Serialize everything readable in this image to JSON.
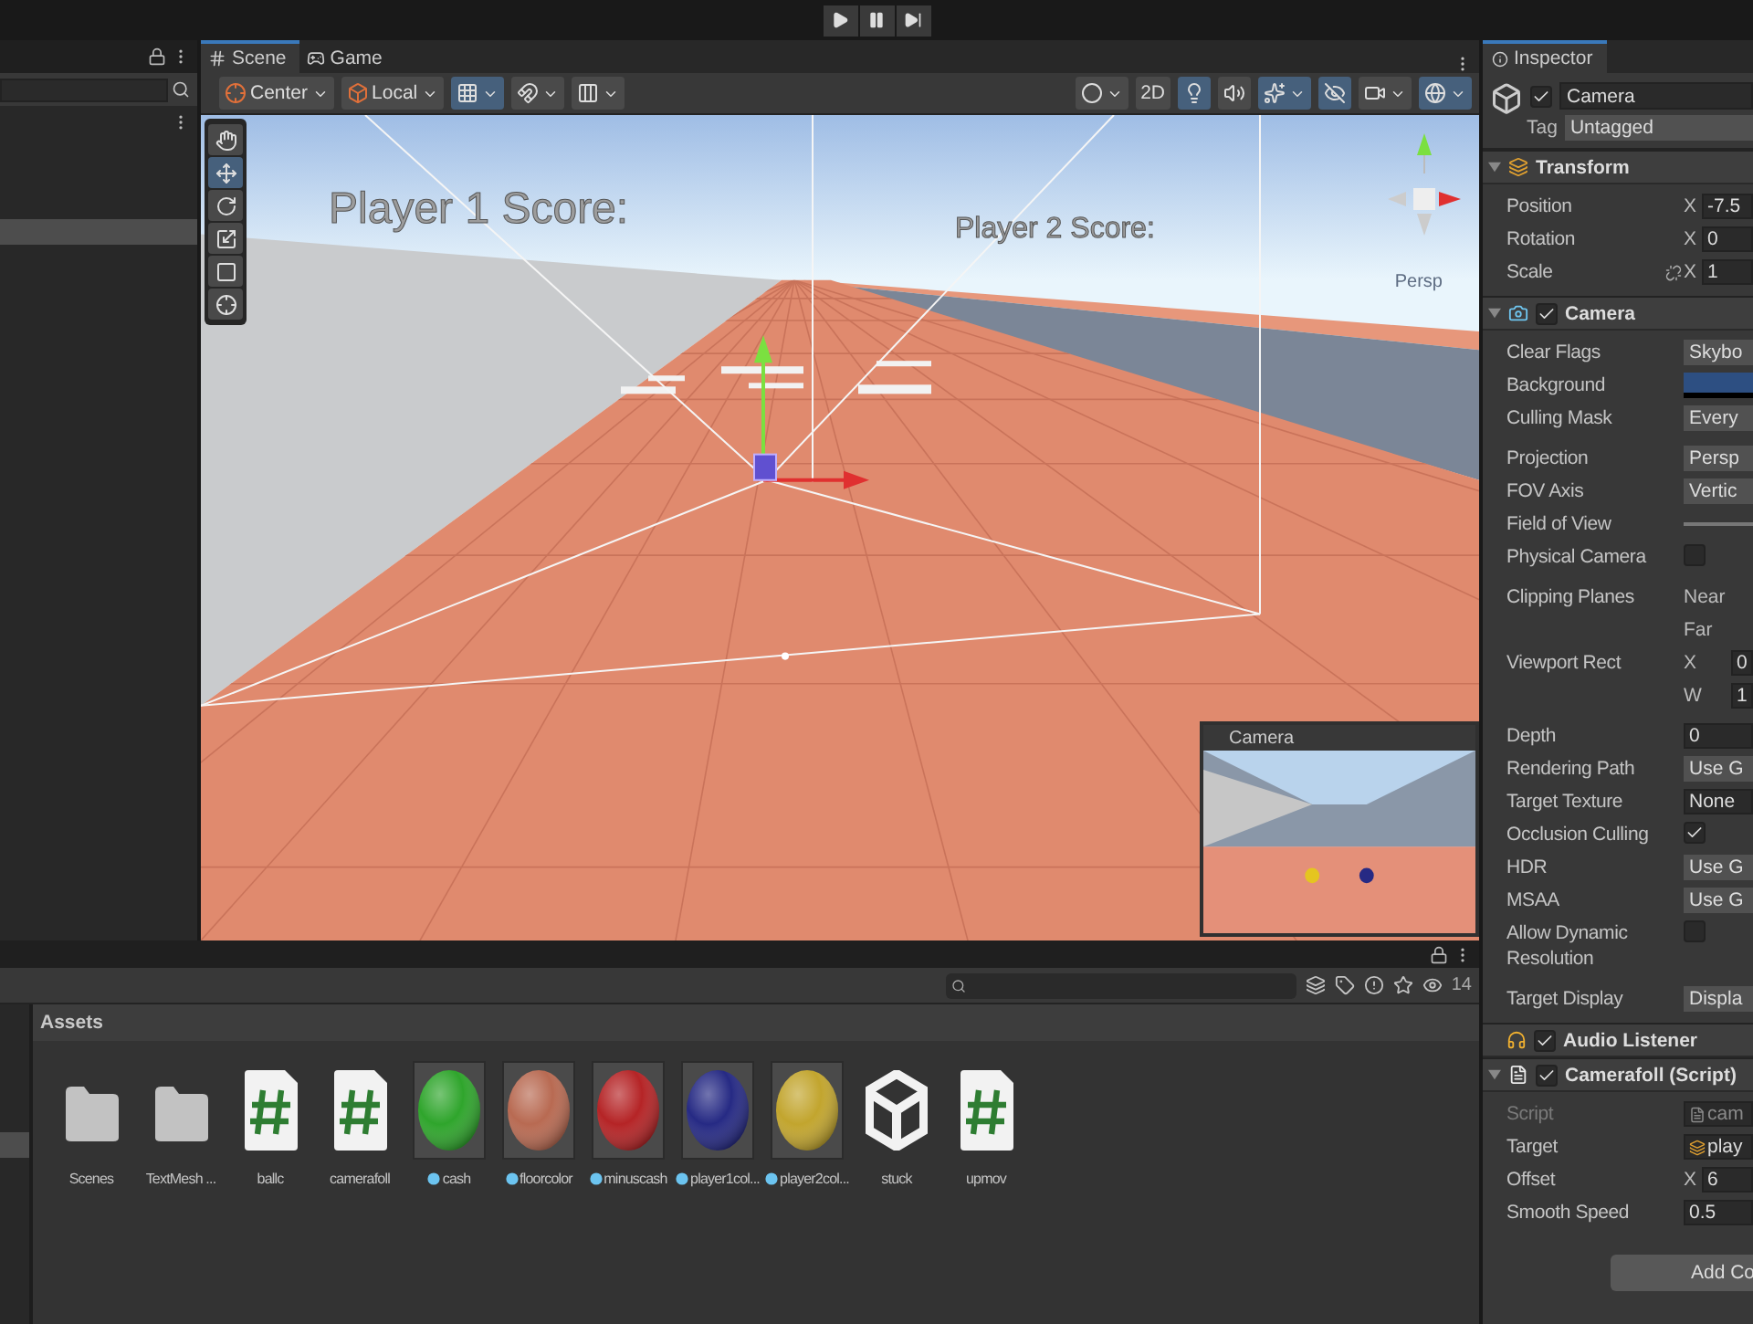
{
  "toolbar": {
    "buttons": [
      {
        "kind": "play"
      },
      {
        "kind": "pause"
      },
      {
        "kind": "step"
      }
    ]
  },
  "scene_view": {
    "tabs": [
      {
        "kind": "scene",
        "label": "Scene",
        "selected": true
      },
      {
        "kind": "game",
        "label": "Game",
        "selected": false
      }
    ],
    "left_tools": [
      {
        "kind": "pivot",
        "label": "Center",
        "dropdown": true,
        "on": false
      },
      {
        "kind": "space",
        "label": "Local",
        "dropdown": true,
        "on": false
      },
      {
        "kind": "grid_snap",
        "dropdown": true,
        "on": true
      },
      {
        "kind": "increment_snap",
        "dropdown": true,
        "on": false
      },
      {
        "kind": "grid",
        "dropdown": true,
        "on": false
      }
    ],
    "right_tools": [
      {
        "kind": "shading",
        "dropdown": true,
        "on": false
      },
      {
        "kind": "mode2d",
        "label": "2D",
        "dropdown": false,
        "on": false
      },
      {
        "kind": "lighting",
        "dropdown": false,
        "on": true
      },
      {
        "kind": "audio",
        "dropdown": false,
        "on": false
      },
      {
        "kind": "effects",
        "dropdown": true,
        "on": true
      },
      {
        "kind": "visibility",
        "dropdown": false,
        "on": true
      },
      {
        "kind": "camera",
        "dropdown": true,
        "on": false
      },
      {
        "kind": "gizmos",
        "dropdown": true,
        "on": true
      }
    ],
    "tools": [
      {
        "kind": "view",
        "selected": false
      },
      {
        "kind": "move",
        "selected": true
      },
      {
        "kind": "rotate",
        "selected": false
      },
      {
        "kind": "scale",
        "selected": false
      },
      {
        "kind": "rect",
        "selected": false
      },
      {
        "kind": "transform",
        "selected": false
      }
    ],
    "score_labels": [
      "Player 1 Score:",
      "Player 2 Score:"
    ],
    "orientation_label": "Persp",
    "camera_preview": {
      "title": "Camera"
    }
  },
  "inspector": {
    "tab": "Inspector",
    "object": {
      "enabled": true,
      "name": "Camera",
      "tag_label": "Tag",
      "tag": "Untagged"
    },
    "components": [
      {
        "kind": "transform",
        "name": "Transform",
        "expanded": true,
        "groups": [
          [
            {
              "kind": "vector",
              "label": "Position",
              "axis": "X",
              "value": "-7.5",
              "constrain": false
            },
            {
              "kind": "vector",
              "label": "Rotation",
              "axis": "X",
              "value": "0",
              "constrain": false
            },
            {
              "kind": "vector",
              "label": "Scale",
              "axis": "X",
              "value": "1",
              "constrain": true
            }
          ]
        ]
      },
      {
        "kind": "camera",
        "name": "Camera",
        "expanded": true,
        "enabled": true,
        "groups": [
          [
            {
              "kind": "dropdown",
              "label": "Clear Flags",
              "value": "Skybo"
            },
            {
              "kind": "color",
              "label": "Background",
              "color": "#2d4f82"
            },
            {
              "kind": "dropdown",
              "label": "Culling Mask",
              "value": "Every"
            }
          ],
          [
            {
              "kind": "dropdown",
              "label": "Projection",
              "value": "Persp"
            },
            {
              "kind": "dropdown",
              "label": "FOV Axis",
              "value": "Vertic"
            },
            {
              "kind": "slider",
              "label": "Field of View"
            },
            {
              "kind": "checkbox",
              "label": "Physical Camera",
              "checked": false
            }
          ],
          [
            {
              "kind": "pair",
              "label": "Clipping Planes",
              "rows": [
                {
                  "axis": "Near"
                },
                {
                  "axis": "Far"
                }
              ]
            },
            {
              "kind": "pair",
              "label": "Viewport Rect",
              "rows": [
                {
                  "axis": "X",
                  "value": "0"
                },
                {
                  "axis": "W",
                  "value": "1"
                }
              ]
            }
          ],
          [
            {
              "kind": "text",
              "label": "Depth",
              "value": "0"
            },
            {
              "kind": "dropdown",
              "label": "Rendering Path",
              "value": "Use G"
            },
            {
              "kind": "object",
              "label": "Target Texture",
              "value": "None"
            },
            {
              "kind": "checkbox",
              "label": "Occlusion Culling",
              "checked": true
            },
            {
              "kind": "dropdown",
              "label": "HDR",
              "value": "Use G"
            },
            {
              "kind": "dropdown",
              "label": "MSAA",
              "value": "Use G"
            },
            {
              "kind": "checkbox",
              "label": "Allow Dynamic Resolution",
              "checked": false
            }
          ],
          [
            {
              "kind": "dropdown",
              "label": "Target Display",
              "value": "Displa"
            }
          ]
        ]
      },
      {
        "kind": "audio",
        "name": "Audio Listener",
        "enabled": true
      },
      {
        "kind": "script",
        "name": "Camerafoll (Script)",
        "expanded": true,
        "enabled": true,
        "groups": [
          [
            {
              "kind": "script_ref",
              "label": "Script",
              "value": "cam",
              "disabled": true
            },
            {
              "kind": "object_ref",
              "label": "Target",
              "value": "play",
              "disabled": false
            },
            {
              "kind": "vector",
              "label": "Offset",
              "axis": "X",
              "value": "6",
              "constrain": false,
              "disabled": false
            },
            {
              "kind": "text",
              "label": "Smooth Speed",
              "value": "0.5",
              "disabled": false
            }
          ]
        ]
      }
    ],
    "add_button": "Add Co"
  },
  "project": {
    "count": "14",
    "breadcrumb": "Assets",
    "assets": [
      {
        "kind": "folder",
        "name": "Scenes"
      },
      {
        "kind": "folder",
        "name": "TextMesh ..."
      },
      {
        "kind": "script",
        "name": "ballc"
      },
      {
        "kind": "script",
        "name": "camerafoll"
      },
      {
        "kind": "material",
        "name": "cash",
        "color": "#2fa52c"
      },
      {
        "kind": "material",
        "name": "floorcolor",
        "color": "#b86a52"
      },
      {
        "kind": "material",
        "name": "minuscash",
        "color": "#b52426"
      },
      {
        "kind": "material",
        "name": "player1col...",
        "color": "#262a84"
      },
      {
        "kind": "material",
        "name": "player2col...",
        "color": "#c2a52e"
      },
      {
        "kind": "prefab",
        "name": "stuck"
      },
      {
        "kind": "script",
        "name": "upmov"
      }
    ]
  }
}
